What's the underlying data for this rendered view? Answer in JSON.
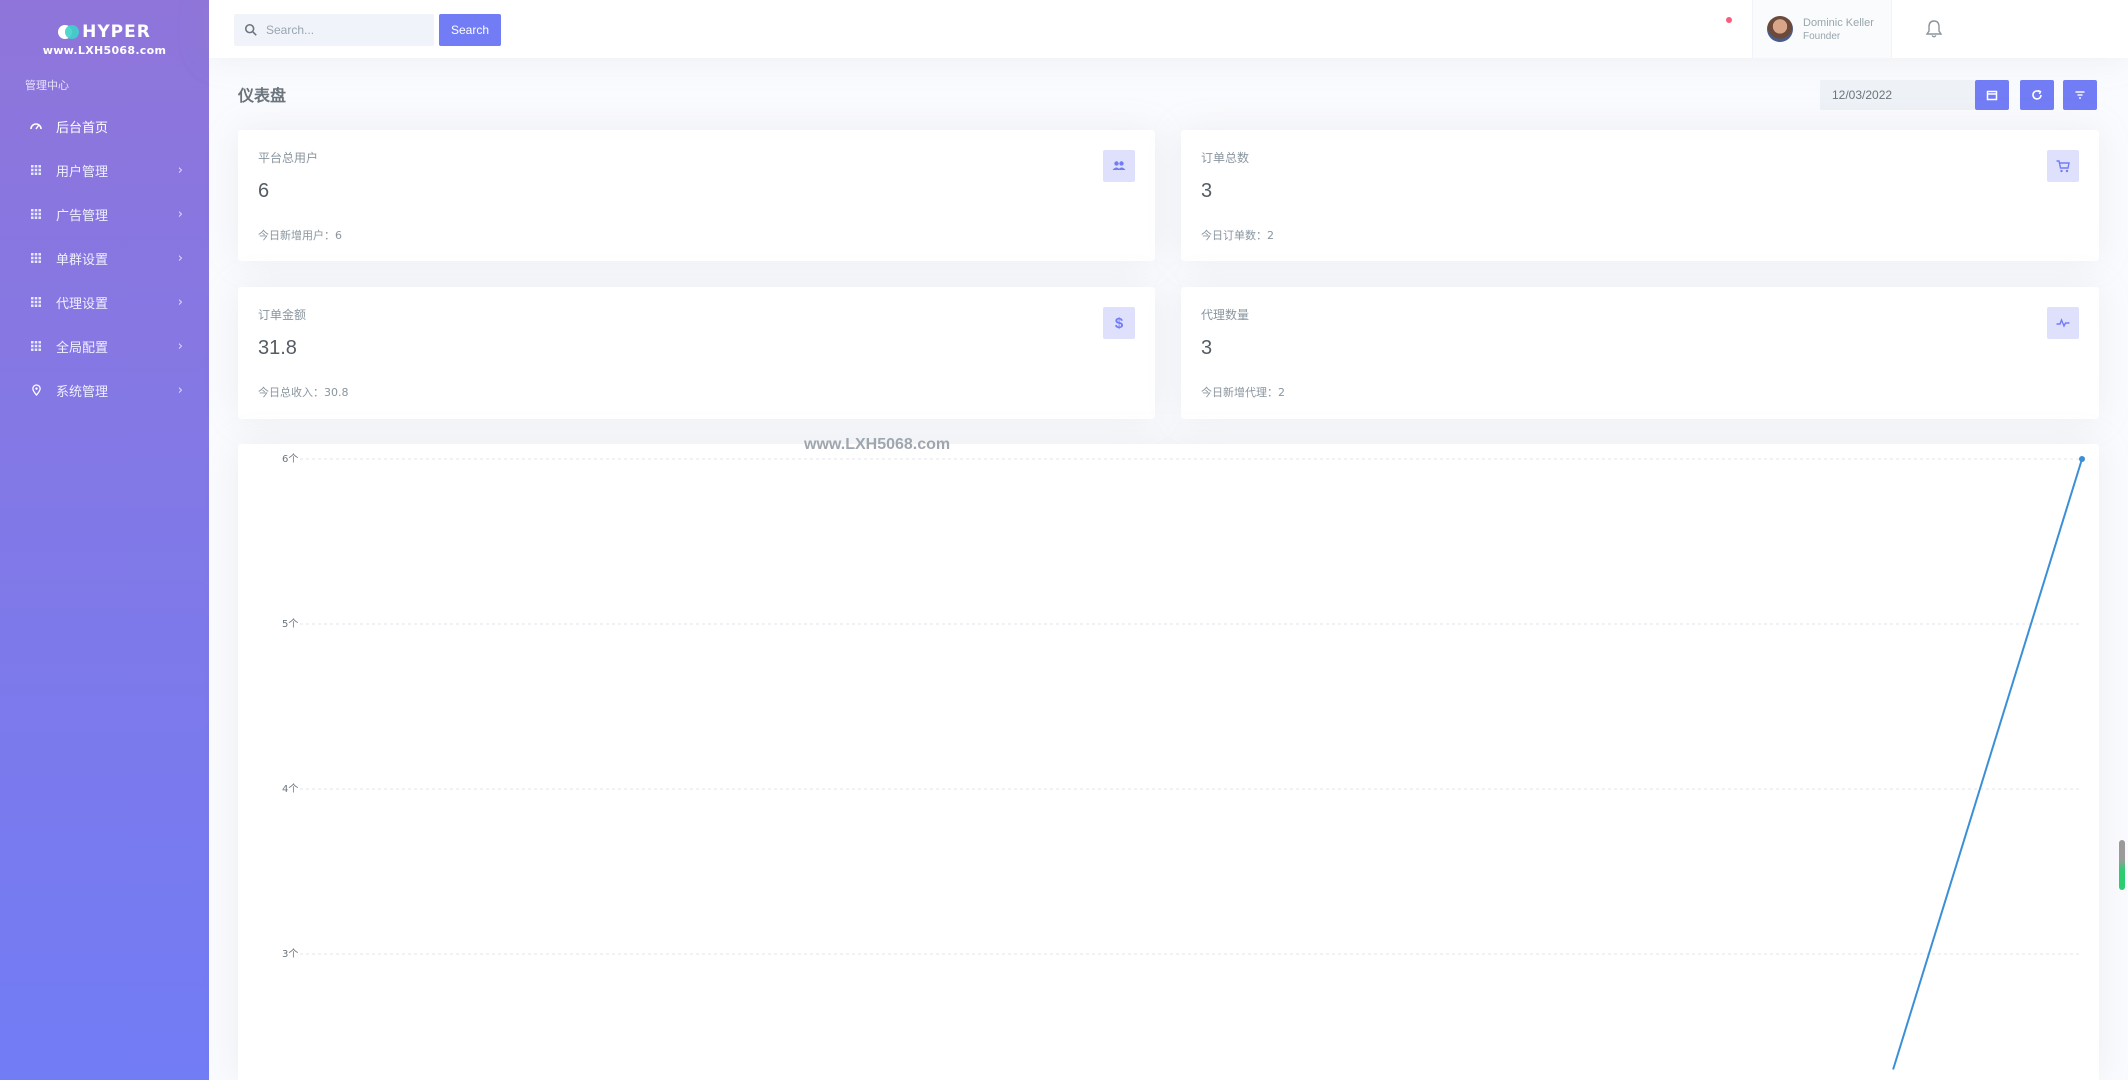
{
  "brand": {
    "name": "HYPER",
    "url": "www.LXH5068.com"
  },
  "sidebar": {
    "section_title": "管理中心",
    "items": [
      {
        "label": "后台首页",
        "icon": "dashboard-icon",
        "active": true,
        "expandable": false
      },
      {
        "label": "用户管理",
        "icon": "grid-icon",
        "active": false,
        "expandable": true
      },
      {
        "label": "广告管理",
        "icon": "grid-icon",
        "active": false,
        "expandable": true
      },
      {
        "label": "单群设置",
        "icon": "grid-icon",
        "active": false,
        "expandable": true
      },
      {
        "label": "代理设置",
        "icon": "grid-icon",
        "active": false,
        "expandable": true
      },
      {
        "label": "全局配置",
        "icon": "grid-icon",
        "active": false,
        "expandable": true
      },
      {
        "label": "系统管理",
        "icon": "location-pin-icon",
        "active": false,
        "expandable": true
      }
    ],
    "chevron": "›"
  },
  "topbar": {
    "search_placeholder": "Search...",
    "search_button": "Search",
    "user": {
      "name": "Dominic Keller",
      "role": "Founder"
    }
  },
  "page": {
    "title": "仪表盘",
    "date_value": "12/03/2022"
  },
  "stats": [
    {
      "label": "平台总用户",
      "value": "6",
      "foot": "今日新增用户：6",
      "icon": "users-icon"
    },
    {
      "label": "订单总数",
      "value": "3",
      "foot": "今日订单数：2",
      "icon": "cart-icon"
    },
    {
      "label": "订单金额",
      "value": "31.8",
      "foot": "今日总收入：30.8",
      "icon": "dollar-icon",
      "icon_glyph": "$"
    },
    {
      "label": "代理数量",
      "value": "3",
      "foot": "今日新增代理：2",
      "icon": "pulse-icon"
    }
  ],
  "watermark": "www.LXH5068.com",
  "colors": {
    "accent": "#727cf5",
    "sidebar_top": "#8f75da",
    "sidebar_bottom": "#727cf5",
    "line": "#3b8fd6"
  },
  "chart_data": {
    "type": "line",
    "title": "",
    "xlabel": "",
    "ylabel": "",
    "y_ticks": [
      "6个",
      "5个",
      "4个",
      "3个"
    ],
    "ylim_visible": [
      3,
      6
    ],
    "grid": true,
    "series": [
      {
        "points": [
          {
            "x_frac": 0.894,
            "y": 2.3
          },
          {
            "x_frac": 1.0,
            "y": 6
          }
        ]
      }
    ]
  }
}
